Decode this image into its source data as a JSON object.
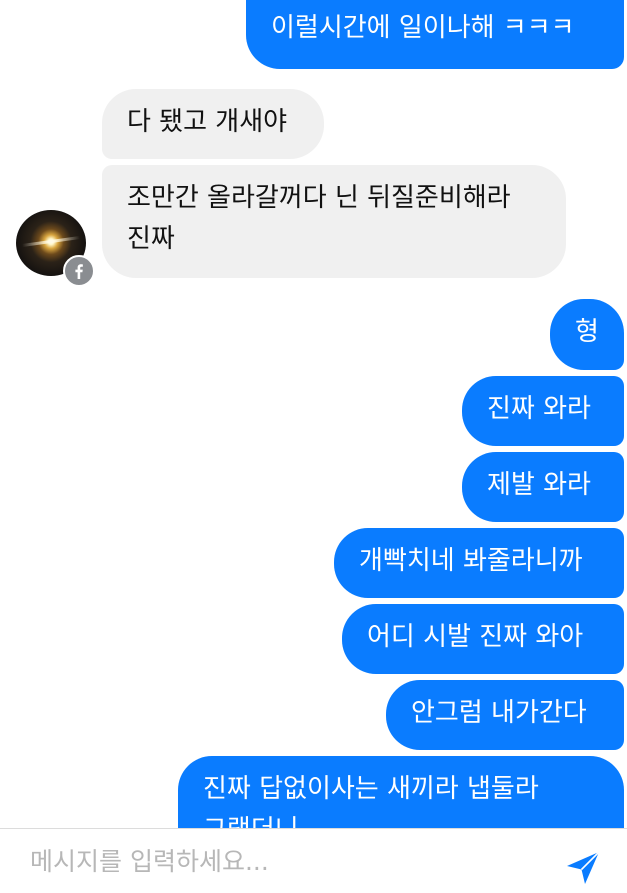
{
  "messages": [
    {
      "side": "out",
      "text": "이럴시간에 일이나해 ㅋㅋㅋ"
    },
    {
      "side": "in",
      "text": "다 됐고 개새야"
    },
    {
      "side": "in",
      "text": "조만간 올라갈꺼다 닌 뒤질준비해라 진짜"
    },
    {
      "side": "out",
      "text": "형"
    },
    {
      "side": "out",
      "text": "진짜 와라"
    },
    {
      "side": "out",
      "text": "제발 와라"
    },
    {
      "side": "out",
      "text": "개빡치네 봐줄라니까"
    },
    {
      "side": "out",
      "text": "어디 시발 진짜 와아"
    },
    {
      "side": "out",
      "text": "안그럼 내가간다"
    },
    {
      "side": "out",
      "text": "진짜 답없이사는 새끼라 냅둘라 그랬더니"
    }
  ],
  "contact": {
    "avatar_icon": "profile-photo",
    "badge_icon": "facebook-icon"
  },
  "composer": {
    "placeholder": "메시지를 입력하세요...",
    "value": "",
    "send_icon": "send-arrow-icon"
  },
  "colors": {
    "outgoing_bubble": "#0a7cff",
    "incoming_bubble": "#f0f0f0",
    "send_icon": "#0a7cff"
  }
}
